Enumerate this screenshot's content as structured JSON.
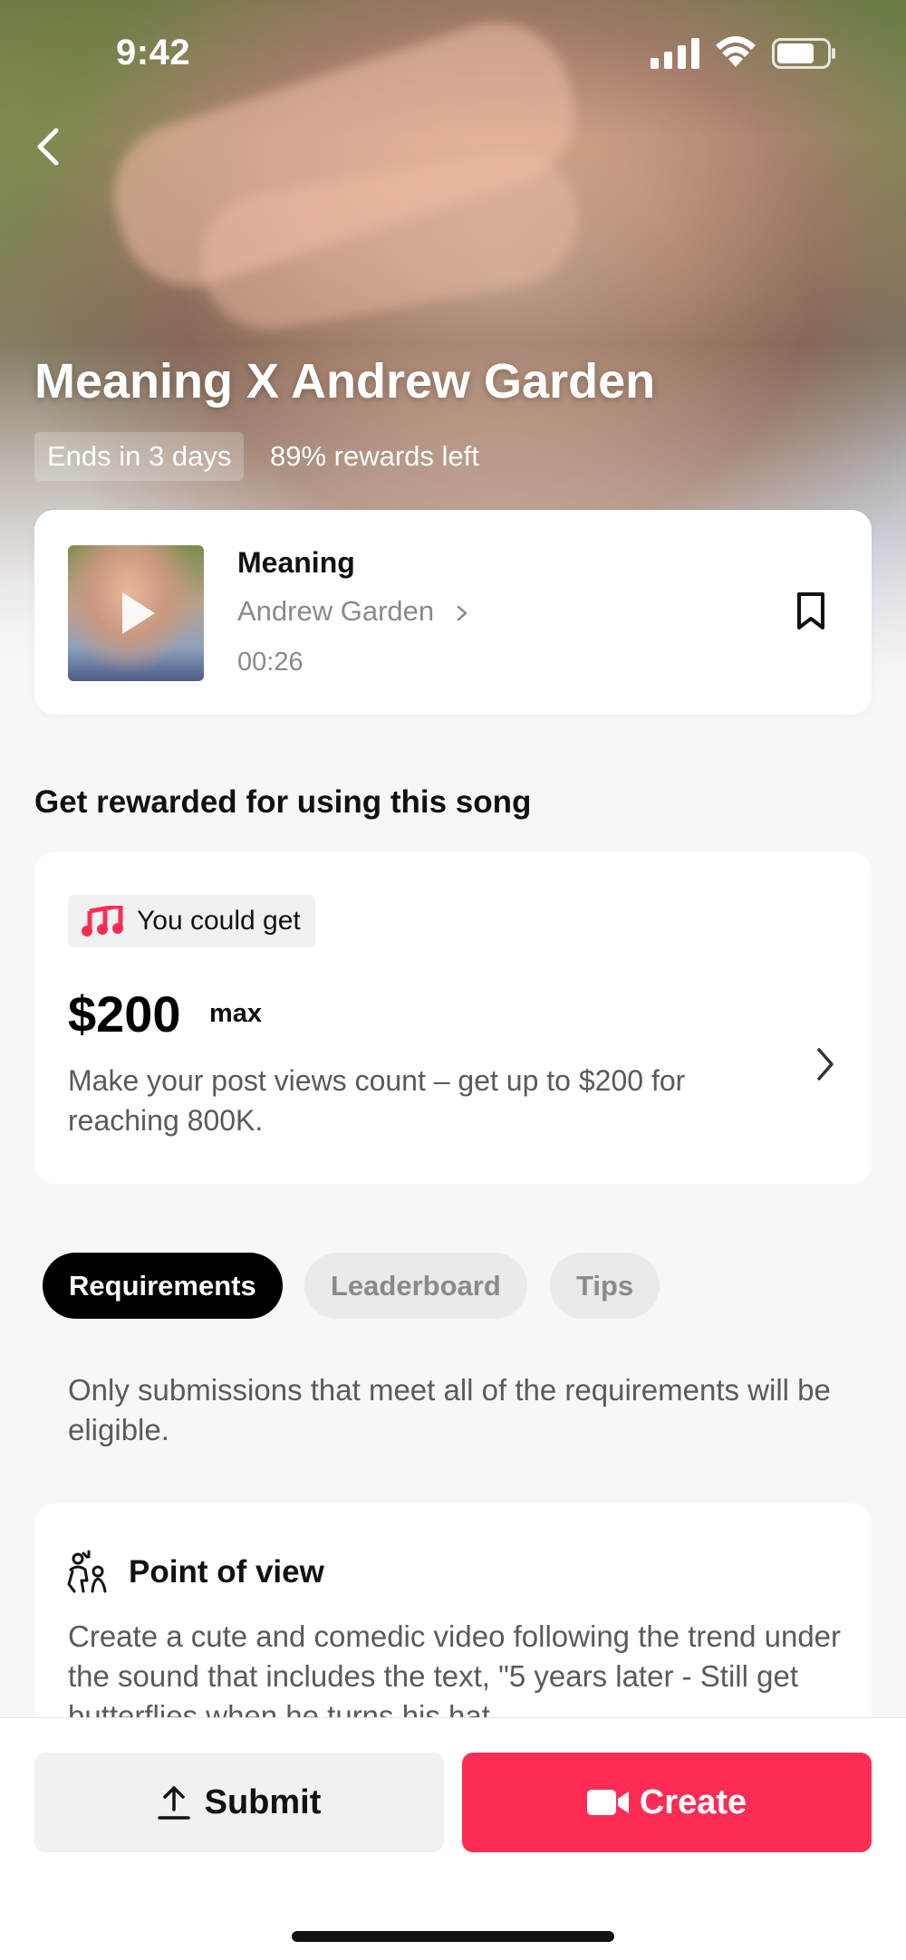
{
  "status_bar": {
    "time": "9:42"
  },
  "hero": {
    "title": "Meaning X Andrew Garden",
    "ends_chip": "Ends in 3 days",
    "rewards_left": "89% rewards left"
  },
  "song": {
    "title": "Meaning",
    "artist": "Andrew Garden",
    "duration": "00:26"
  },
  "rewards_section": {
    "title": "Get rewarded for using this song",
    "badge_label": "You could get",
    "amount": "$200",
    "amount_suffix": "max",
    "description": "Make your post views count – get up to $200 for reaching 800K."
  },
  "tabs": [
    {
      "label": "Requirements",
      "active": true
    },
    {
      "label": "Leaderboard",
      "active": false
    },
    {
      "label": "Tips",
      "active": false
    }
  ],
  "requirements": {
    "note": "Only submissions that meet all of the requirements will be eligible.",
    "pov_title": "Point of view",
    "pov_text": "Create a cute and comedic video following the trend under the sound that includes the text, \"5 years later - Still get butterflies when he turns his hat"
  },
  "actions": {
    "submit_label": "Submit",
    "create_label": "Create"
  },
  "colors": {
    "accent": "#fe2c55",
    "music_icon": "#fe2c55"
  }
}
